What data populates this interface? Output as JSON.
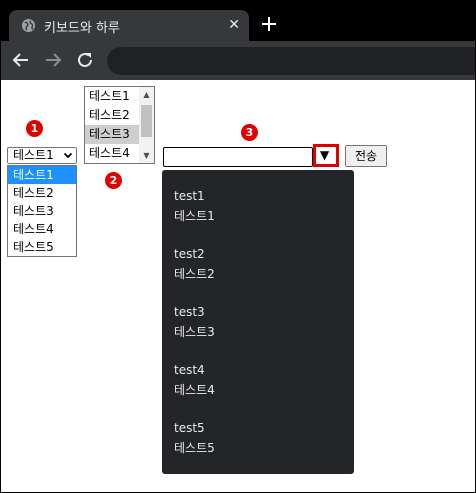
{
  "browser": {
    "tab_title": "키보드와 하루",
    "tab_close": "✕",
    "new_tab": "+"
  },
  "markers": [
    "1",
    "2",
    "3"
  ],
  "select1": {
    "value": "테스트1",
    "options": [
      "테스트1",
      "테스트2",
      "테스트3",
      "테스트4",
      "테스트5"
    ]
  },
  "listbox": {
    "items": [
      "테스트1",
      "테스트2",
      "테스트3",
      "테스트4"
    ],
    "selected_index": 2
  },
  "input3": {
    "value": "",
    "dropdown_arrow": "▼",
    "submit_label": "전송"
  },
  "datalist": {
    "options": [
      {
        "value": "test1",
        "label": "테스트1"
      },
      {
        "value": "test2",
        "label": "테스트2"
      },
      {
        "value": "test3",
        "label": "테스트3"
      },
      {
        "value": "test4",
        "label": "테스트4"
      },
      {
        "value": "test5",
        "label": "테스트5"
      }
    ]
  },
  "colors": {
    "marker": "#e00000",
    "selected_option": "#1e90ff",
    "datalist_bg": "#242528",
    "chrome_dark": "#36383b"
  }
}
